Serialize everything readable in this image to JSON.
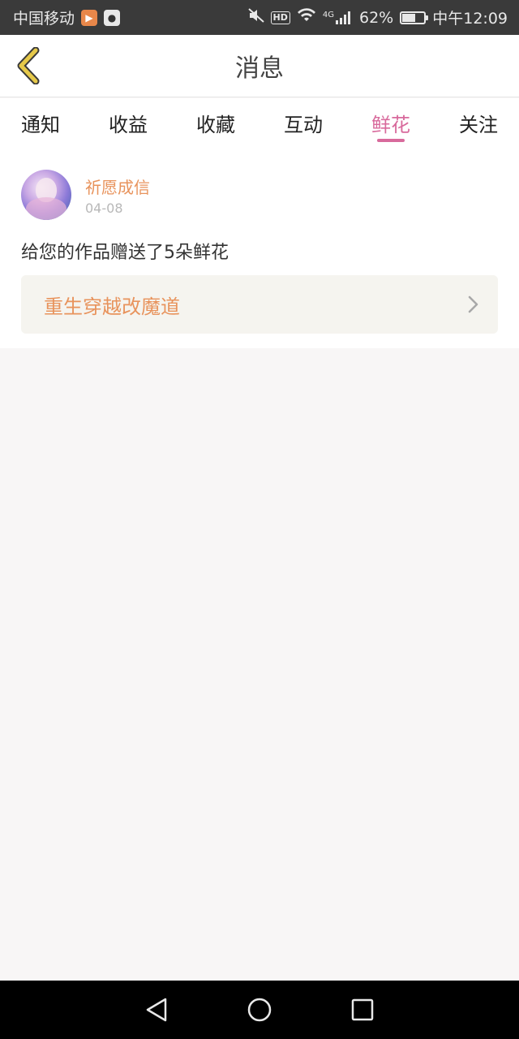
{
  "status_bar": {
    "carrier": "中国移动",
    "network": "4G",
    "battery": "62%",
    "time": "中午12:09",
    "battery_level": 0.62,
    "hd_label": "HD"
  },
  "header": {
    "title": "消息",
    "back_icon": "chevron-left-icon"
  },
  "tabs": [
    {
      "label": "通知",
      "active": false
    },
    {
      "label": "收益",
      "active": false
    },
    {
      "label": "收藏",
      "active": false
    },
    {
      "label": "互动",
      "active": false
    },
    {
      "label": "鲜花",
      "active": true
    },
    {
      "label": "关注",
      "active": false
    }
  ],
  "message": {
    "user_name": "祈愿成信",
    "date": "04-08",
    "text": "给您的作品赠送了5朵鲜花",
    "work_title": "重生穿越改魔道"
  },
  "colors": {
    "accent_pink": "#d86a9c",
    "accent_orange": "#e8935c",
    "back_arrow": "#e6c94a"
  }
}
